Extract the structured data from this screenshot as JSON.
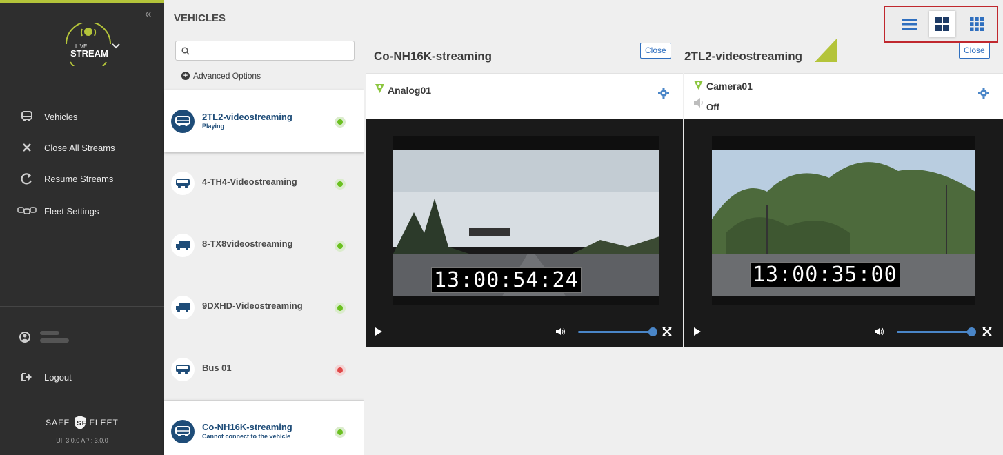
{
  "sidebar": {
    "logo": {
      "small": "LIVE",
      "big": "STREAM"
    },
    "nav": [
      {
        "label": "Vehicles",
        "icon": "bus-icon"
      },
      {
        "label": "Close All Streams",
        "icon": "close-icon"
      },
      {
        "label": "Resume Streams",
        "icon": "refresh-icon"
      },
      {
        "label": "Fleet Settings",
        "icon": "fleet-icon"
      }
    ],
    "logout_label": "Logout",
    "brand_left": "SAFE",
    "brand_right": "FLEET",
    "version": "UI: 3.0.0 API: 3.0.0"
  },
  "vehicles": {
    "title": "VEHICLES",
    "search_placeholder": "",
    "advanced_label": "Advanced Options",
    "items": [
      {
        "name": "2TL2-videostreaming",
        "status": "Playing",
        "state": "green",
        "active": true
      },
      {
        "name": "4-TH4-Videostreaming",
        "status": "",
        "state": "green",
        "active": false
      },
      {
        "name": "8-TX8videostreaming",
        "status": "",
        "state": "green",
        "active": false
      },
      {
        "name": "9DXHD-Videostreaming",
        "status": "",
        "state": "green",
        "active": false
      },
      {
        "name": "Bus 01",
        "status": "",
        "state": "red",
        "active": false
      },
      {
        "name": "Co-NH16K-streaming",
        "status": "Cannot connect to the vehicle",
        "state": "green",
        "active": true
      }
    ]
  },
  "panes": [
    {
      "title": "Co-NH16K-streaming",
      "close_label": "Close",
      "camera": "Analog01",
      "audio": "",
      "timestamp": "13:00:54:24",
      "volume": 1.0
    },
    {
      "title": "2TL2-videostreaming",
      "close_label": "Close",
      "camera": "Camera01",
      "audio": "Off",
      "timestamp": "13:00:35:00",
      "volume": 1.0
    }
  ],
  "layout_options": [
    "list-layout-icon",
    "grid-2x2-icon",
    "grid-3x3-icon"
  ],
  "selected_layout": "grid-2x2-icon",
  "colors": {
    "accent": "#b4c43a",
    "blue": "#1e4c78",
    "link": "#2f6fbf",
    "highlight_border": "#c0282e"
  }
}
